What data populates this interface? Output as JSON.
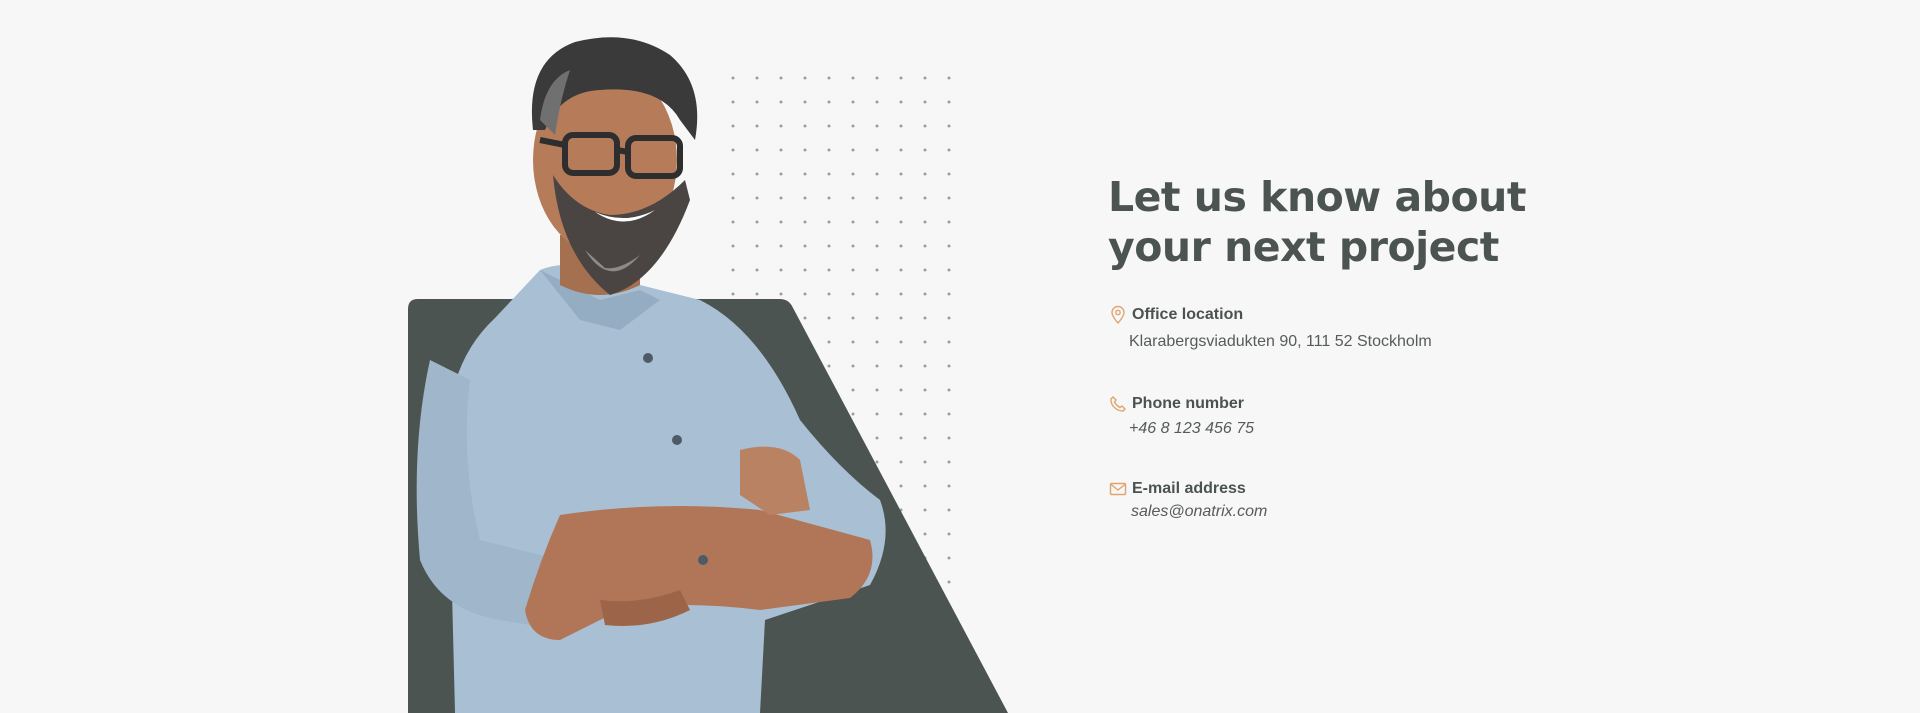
{
  "heading": {
    "line1": "Let us know about",
    "line2": "your next project"
  },
  "contact": {
    "location": {
      "label": "Office location",
      "value": "Klarabergsviadukten 90, 111 52 Stockholm",
      "icon": "map-pin-icon"
    },
    "phone": {
      "label": "Phone number",
      "value": "+46 8 123 456 75",
      "icon": "phone-icon"
    },
    "email": {
      "label": "E-mail address",
      "value": "sales@onatrix.com",
      "icon": "mail-icon"
    }
  },
  "colors": {
    "background": "#f7f7f7",
    "panel": "#4b5450",
    "accent": "#e0a46f",
    "text": "#4b5350"
  }
}
